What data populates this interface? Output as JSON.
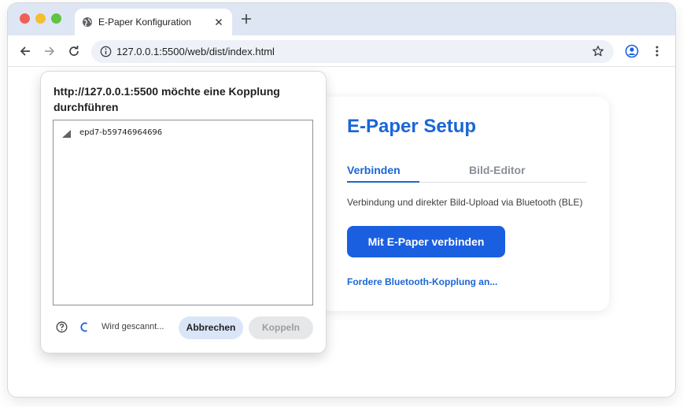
{
  "browser": {
    "tab_title": "E-Paper Konfiguration",
    "url": "127.0.0.1:5500/web/dist/index.html",
    "icons": [
      "globe-icon",
      "close-icon",
      "plus-icon",
      "back-icon",
      "forward-icon",
      "reload-icon",
      "info-icon",
      "star-icon",
      "profile-icon",
      "more-icon"
    ]
  },
  "card": {
    "title": "E-Paper Setup",
    "tabs": [
      {
        "label": "Verbinden",
        "active": true
      },
      {
        "label": "Bild-Editor",
        "active": false
      }
    ],
    "description": "Verbindung und direkter Bild-Upload via Bluetooth (BLE)",
    "connect_button": "Mit E-Paper verbinden",
    "pair_link": "Fordere Bluetooth-Kopplung an...",
    "accent_color": "#1a66d6"
  },
  "dialog": {
    "title": "http://127.0.0.1:5500 möchte eine Kopplung durchführen",
    "devices": [
      {
        "name": "epd7-b59746964696"
      }
    ],
    "status": "Wird gescannt...",
    "cancel_button": "Abbrechen",
    "pair_button": "Koppeln"
  }
}
